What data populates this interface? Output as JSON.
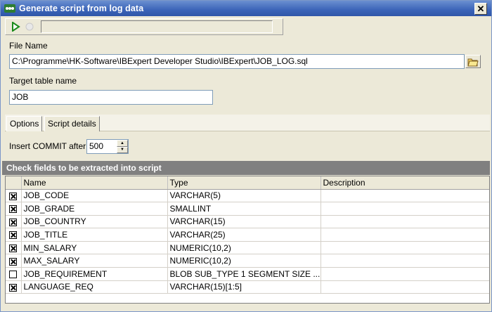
{
  "window": {
    "title": "Generate script from log data"
  },
  "icons": {
    "app": "app-icon",
    "close": "close-icon",
    "run": "run-icon",
    "stop": "stop-icon",
    "browse": "folder-icon"
  },
  "file": {
    "label": "File Name",
    "value": "C:\\Programme\\HK-Software\\IBExpert Developer Studio\\IBExpert\\JOB_LOG.sql"
  },
  "target": {
    "label": "Target table name",
    "value": "JOB"
  },
  "tabs": [
    {
      "label": "Options"
    },
    {
      "label": "Script details"
    }
  ],
  "options": {
    "commit_label": "Insert COMMIT after",
    "commit_value": "500"
  },
  "grid": {
    "title": "Check fields to be extracted into script",
    "columns": [
      "Name",
      "Type",
      "Description"
    ],
    "rows": [
      {
        "checked": true,
        "name": "JOB_CODE",
        "type": "VARCHAR(5)",
        "description": ""
      },
      {
        "checked": true,
        "name": "JOB_GRADE",
        "type": "SMALLINT",
        "description": ""
      },
      {
        "checked": true,
        "name": "JOB_COUNTRY",
        "type": "VARCHAR(15)",
        "description": ""
      },
      {
        "checked": true,
        "name": "JOB_TITLE",
        "type": "VARCHAR(25)",
        "description": ""
      },
      {
        "checked": true,
        "name": "MIN_SALARY",
        "type": "NUMERIC(10,2)",
        "description": ""
      },
      {
        "checked": true,
        "name": "MAX_SALARY",
        "type": "NUMERIC(10,2)",
        "description": ""
      },
      {
        "checked": false,
        "name": "JOB_REQUIREMENT",
        "type": "BLOB SUB_TYPE 1 SEGMENT SIZE ...",
        "description": ""
      },
      {
        "checked": true,
        "name": "LANGUAGE_REQ",
        "type": "VARCHAR(15)[1:5]",
        "description": ""
      }
    ]
  },
  "colors": {
    "titlebar": "#3b64b8",
    "accent_green": "#1a8a1a"
  }
}
